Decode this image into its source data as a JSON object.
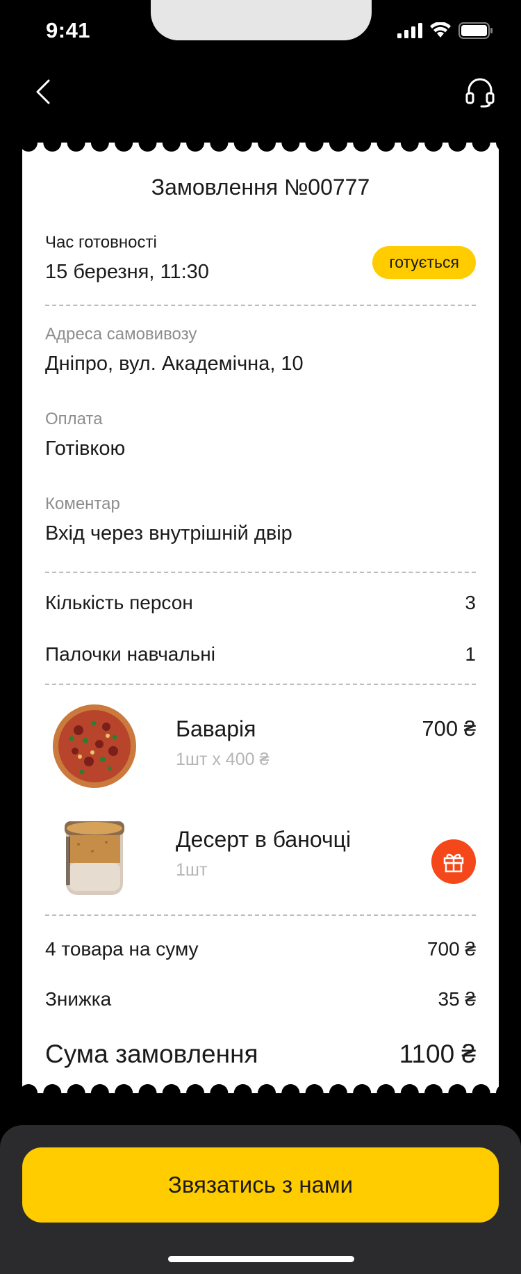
{
  "status_bar": {
    "time": "9:41"
  },
  "order": {
    "title": "Замовлення №00777",
    "ready_time_label": "Час готовності",
    "ready_time_value": "15 березня, 11:30",
    "status_badge": "готується",
    "pickup_label": "Адреса самовивозу",
    "pickup_value": "Дніпро, вул. Академічна, 10",
    "payment_label": "Оплата",
    "payment_value": "Готівкою",
    "comment_label": "Коментар",
    "comment_value": "Вхід через внутрішній двір"
  },
  "extras": [
    {
      "label": "Кількість персон",
      "value": "3"
    },
    {
      "label": "Палочки навчальні",
      "value": "1"
    }
  ],
  "items": [
    {
      "name": "Баварія",
      "sub": "1шт х 400 ₴",
      "price": "700 ₴",
      "image": "pizza-image"
    },
    {
      "name": "Десерт в баночці",
      "sub": "1шт",
      "gift": "gift-icon",
      "image": "dessert-jar-image"
    }
  ],
  "summary": {
    "goods_label": "4 товара на суму",
    "goods_value": "700 ₴",
    "discount_label": "Знижка",
    "discount_value": "35 ₴",
    "total_label": "Сума замовлення",
    "total_value": "1100 ₴"
  },
  "cta_label": "Звязатись з нами",
  "colors": {
    "accent": "#ffcc00",
    "gift": "#f4471a",
    "background": "#000000",
    "sheet": "#2b2b2d"
  }
}
